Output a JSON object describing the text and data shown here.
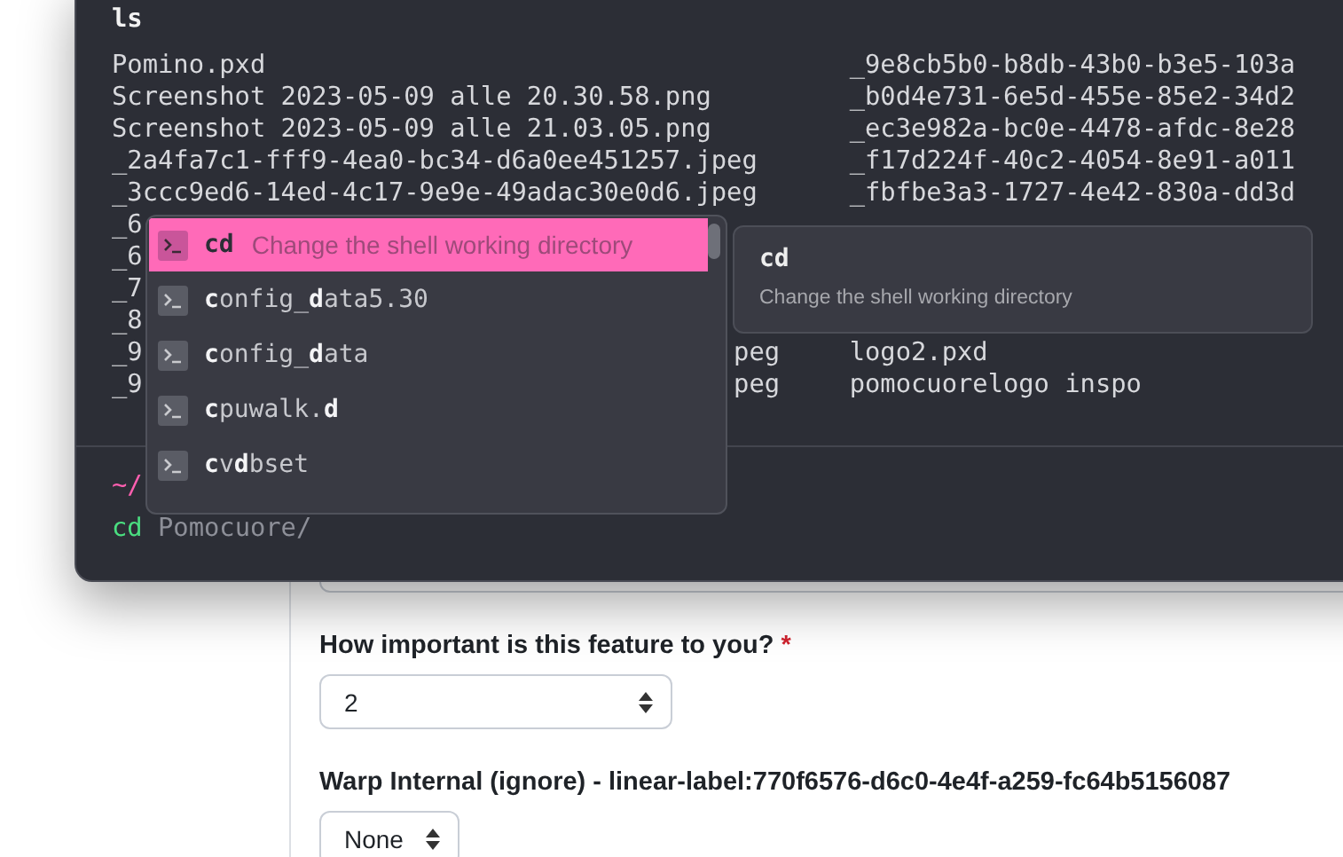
{
  "terminal": {
    "command": "ls",
    "listing": [
      {
        "left": "Pomino.pxd",
        "right": "_9e8cb5b0-b8db-43b0-b3e5-103a"
      },
      {
        "left": "Screenshot 2023-05-09 alle 20.30.58.png",
        "right": "_b0d4e731-6e5d-455e-85e2-34d2"
      },
      {
        "left": "Screenshot 2023-05-09 alle 21.03.05.png",
        "right": "_ec3e982a-bc0e-4478-afdc-8e28"
      },
      {
        "left": "_2a4fa7c1-fff9-4ea0-bc34-d6a0ee451257.jpeg",
        "right": "_f17d224f-40c2-4054-8e91-a011"
      },
      {
        "left": "_3ccc9ed6-14ed-4c17-9e9e-49adac30e0d6.jpeg",
        "right": "_fbfbe3a3-1727-4e42-830a-dd3d"
      },
      {
        "left": "_6"
      },
      {
        "left": "_6"
      },
      {
        "left": "_7"
      },
      {
        "left": "_8"
      },
      {
        "left": "_9",
        "middle": "peg",
        "right": "logo2.pxd"
      },
      {
        "left": "_9",
        "middle": "peg",
        "right": "pomocuorelogo inspo"
      }
    ],
    "prompt_path": "~/",
    "input": {
      "command": "cd",
      "suggestion": "Pomocuore/"
    }
  },
  "completions": [
    {
      "text": "**cd**",
      "description": "Change the shell working directory",
      "selected": true
    },
    {
      "text": "**c**onfig_**d**ata5.30",
      "selected": false
    },
    {
      "text": "**c**onfig_**d**ata",
      "selected": false
    },
    {
      "text": "**c**puwalk.**d**",
      "selected": false
    },
    {
      "text": "**c**v**d**bset",
      "selected": false
    }
  ],
  "tooltip": {
    "title": "cd",
    "description": "Change the shell working directory"
  },
  "form": {
    "fields": [
      {
        "label": "How important is this feature to you?",
        "required": true,
        "required_mark": "*",
        "value": "2"
      },
      {
        "label": "Warp Internal (ignore) - linear-label:770f6576-d6c0-4e4f-a259-fc64b5156087",
        "value": "None"
      }
    ]
  }
}
